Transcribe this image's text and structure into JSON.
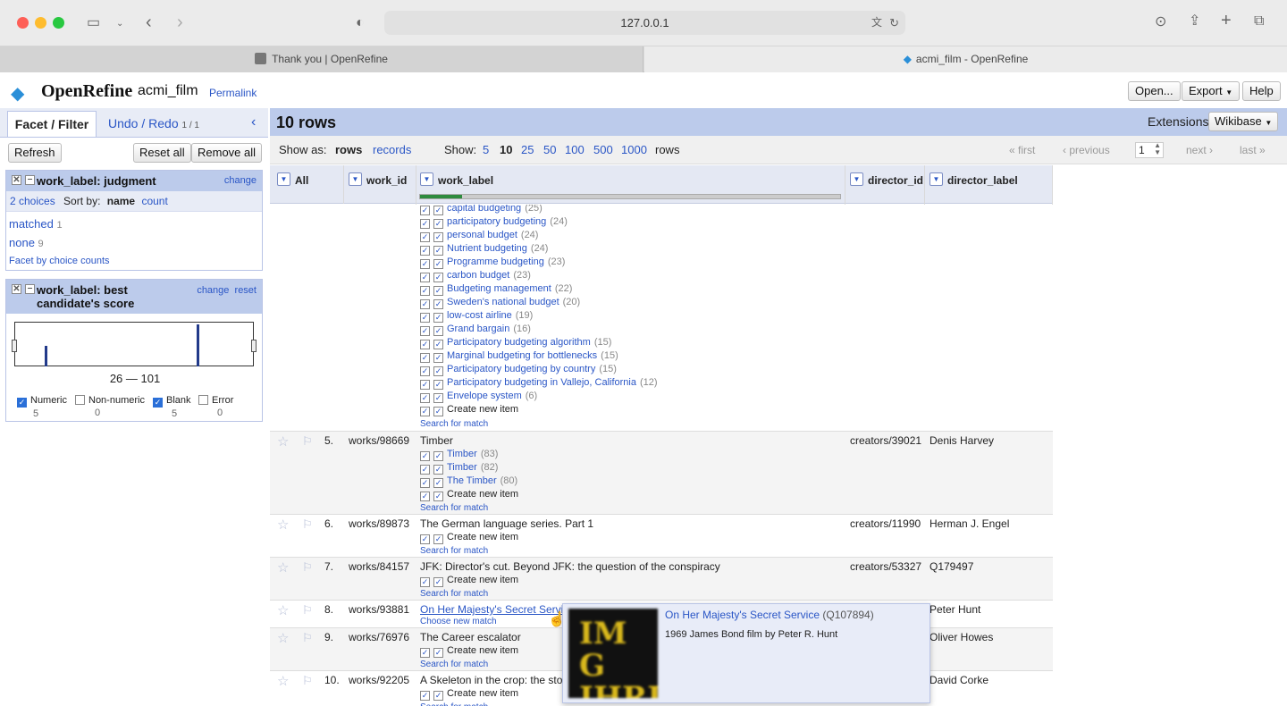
{
  "browser": {
    "url": "127.0.0.1",
    "tabs": [
      {
        "title": "Thank you | OpenRefine"
      },
      {
        "title": "acmi_film - OpenRefine"
      }
    ]
  },
  "app": {
    "logo": "OpenRefine",
    "project": "acmi_film",
    "permalink": "Permalink",
    "buttons": {
      "open": "Open...",
      "export": "Export",
      "help": "Help"
    },
    "extensions_label": "Extensions",
    "wikibase": "Wikibase"
  },
  "left": {
    "tab_facet": "Facet / Filter",
    "tab_undo": "Undo / Redo",
    "undo_count": "1 / 1",
    "refresh": "Refresh",
    "reset_all": "Reset all",
    "remove_all": "Remove all",
    "facet1": {
      "title": "work_label: judgment",
      "change": "change",
      "choices": "2 choices",
      "sort_by": "Sort by:",
      "sort_name": "name",
      "sort_count": "count",
      "items": [
        {
          "label": "matched",
          "count": "1"
        },
        {
          "label": "none",
          "count": "9"
        }
      ],
      "facet_by_counts": "Facet by choice counts"
    },
    "facet2": {
      "title1": "work_label: best",
      "title2": "candidate's score",
      "change": "change",
      "reset": "reset",
      "range": "26 — 101",
      "opts": [
        {
          "label": "Numeric",
          "count": "5",
          "checked": true
        },
        {
          "label": "Non-numeric",
          "count": "0",
          "checked": false
        },
        {
          "label": "Blank",
          "count": "5",
          "checked": true
        },
        {
          "label": "Error",
          "count": "0",
          "checked": false
        }
      ]
    }
  },
  "main": {
    "rows_title": "10 rows",
    "show_as": "Show as:",
    "rows_mode": "rows",
    "records_mode": "records",
    "show": "Show:",
    "page_sizes": [
      "5",
      "10",
      "25",
      "50",
      "100",
      "500",
      "1000"
    ],
    "rows_word": "rows",
    "pager": {
      "first": "« first",
      "previous": "‹ previous",
      "page": "1",
      "next": "next ›",
      "last": "last »"
    },
    "columns": {
      "all": "All",
      "work_id": "work_id",
      "work_label": "work_label",
      "director_id": "director_id",
      "director_label": "director_label"
    },
    "row4_candidates": [
      {
        "label": "capital budgeting",
        "count": "(25)"
      },
      {
        "label": "participatory budgeting",
        "count": "(24)"
      },
      {
        "label": "personal budget",
        "count": "(24)"
      },
      {
        "label": "Nutrient budgeting",
        "count": "(24)"
      },
      {
        "label": "Programme budgeting",
        "count": "(23)"
      },
      {
        "label": "carbon budget",
        "count": "(23)"
      },
      {
        "label": "Budgeting management",
        "count": "(22)"
      },
      {
        "label": "Sweden's national budget",
        "count": "(20)"
      },
      {
        "label": "low-cost airline",
        "count": "(19)"
      },
      {
        "label": "Grand bargain",
        "count": "(16)"
      },
      {
        "label": "Participatory budgeting algorithm",
        "count": "(15)"
      },
      {
        "label": "Marginal budgeting for bottlenecks",
        "count": "(15)"
      },
      {
        "label": "Participatory budgeting by country",
        "count": "(15)"
      },
      {
        "label": "Participatory budgeting in Vallejo, California",
        "count": "(12)"
      },
      {
        "label": "Envelope system",
        "count": "(6)"
      }
    ],
    "create_new": "Create new item",
    "search_match": "Search for match",
    "choose_new": "Choose new match",
    "rows": [
      {
        "num": "5.",
        "work_id": "works/98669",
        "label": "Timber",
        "director_id": "creators/39021",
        "director_label": "Denis Harvey",
        "cands": [
          {
            "label": "Timber",
            "count": "(83)"
          },
          {
            "label": "Timber",
            "count": "(82)"
          },
          {
            "label": "The Timber",
            "count": "(80)"
          }
        ]
      },
      {
        "num": "6.",
        "work_id": "works/89873",
        "label": "The German language series. Part 1",
        "director_id": "creators/11990",
        "director_label": "Herman J. Engel"
      },
      {
        "num": "7.",
        "work_id": "works/84157",
        "label": "JFK: Director's cut. Beyond JFK: the question of the conspiracy",
        "director_id": "creators/53327",
        "director_label": "Q179497"
      },
      {
        "num": "8.",
        "work_id": "works/93881",
        "label": "On Her Majesty's Secret Service",
        "director_label": "Peter Hunt"
      },
      {
        "num": "9.",
        "work_id": "works/76976",
        "label": "The Career escalator",
        "director_label": "Oliver Howes"
      },
      {
        "num": "10.",
        "work_id": "works/92205",
        "label": "A Skeleton in the crop: the story o",
        "director_label": "David Corke"
      }
    ],
    "popup": {
      "title": "On Her Majesty's Secret Service",
      "qid": "(Q107894)",
      "desc": "1969 James Bond film by Peter R. Hunt",
      "img_text1": "IM G",
      "img_text2": "IHRI"
    }
  }
}
